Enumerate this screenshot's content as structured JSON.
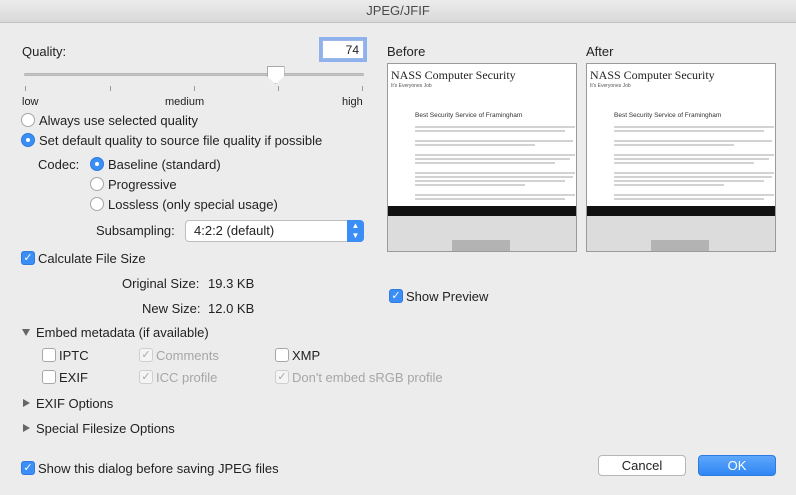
{
  "window": {
    "title": "JPEG/JFIF"
  },
  "quality": {
    "label": "Quality:",
    "value": "74",
    "slider_value": 74,
    "tick_low": "low",
    "tick_medium": "medium",
    "tick_high": "high"
  },
  "options": {
    "always_use_selected": "Always use selected quality",
    "set_default_source": "Set default quality to source file quality if possible"
  },
  "codec": {
    "label": "Codec:",
    "baseline": "Baseline (standard)",
    "progressive": "Progressive",
    "lossless": "Lossless (only special usage)"
  },
  "subsampling": {
    "label": "Subsampling:",
    "value": "4:2:2 (default)"
  },
  "filesize": {
    "calculate_label": "Calculate File Size",
    "original_label": "Original Size:",
    "original_value": "19.3 KB",
    "new_label": "New Size:",
    "new_value": "12.0 KB"
  },
  "metadata": {
    "header": "Embed metadata (if available)",
    "iptc": "IPTC",
    "comments": "Comments",
    "xmp": "XMP",
    "exif": "EXIF",
    "icc_profile": "ICC profile",
    "dont_embed_srgb": "Don't embed sRGB profile"
  },
  "sections": {
    "exif_options": "EXIF Options",
    "special_filesize": "Special Filesize Options"
  },
  "preview": {
    "before_label": "Before",
    "after_label": "After",
    "page_title": "NASS Computer Security",
    "page_subtitle": "It's Everyones Job",
    "page_heading": "Best Security Service of Framingham",
    "show_preview": "Show Preview"
  },
  "footer": {
    "show_dialog": "Show this dialog before saving JPEG files",
    "cancel": "Cancel",
    "ok": "OK"
  },
  "colors": {
    "accent": "#3a8ef5",
    "background": "#ececec"
  }
}
